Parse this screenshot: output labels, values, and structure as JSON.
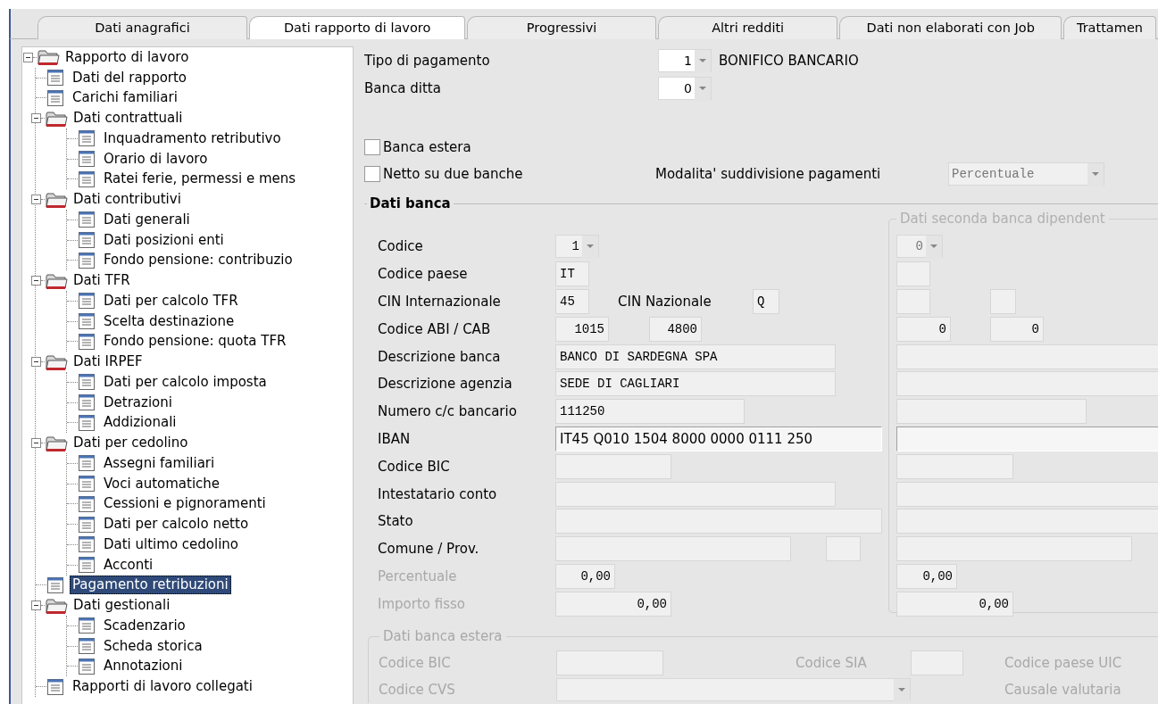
{
  "tabs": [
    {
      "label": "Dati anagrafici",
      "selected": false
    },
    {
      "label": "Dati rapporto di lavoro",
      "selected": true
    },
    {
      "label": "Progressivi",
      "selected": false
    },
    {
      "label": "Altri redditi",
      "selected": false
    },
    {
      "label": "Dati non elaborati con Job",
      "selected": false
    },
    {
      "label": "Trattamen",
      "selected": false
    }
  ],
  "tree": [
    {
      "label": "Rapporto di lavoro",
      "kind": "folder",
      "expanded": true,
      "selected": false,
      "children": [
        {
          "label": "Dati del rapporto",
          "kind": "page",
          "selected": false
        },
        {
          "label": "Carichi familiari",
          "kind": "page",
          "selected": false
        },
        {
          "label": "Dati contrattuali",
          "kind": "folder",
          "expanded": true,
          "selected": false,
          "children": [
            {
              "label": "Inquadramento retributivo",
              "kind": "page",
              "selected": false
            },
            {
              "label": "Orario di lavoro",
              "kind": "page",
              "selected": false
            },
            {
              "label": "Ratei ferie, permessi e mens",
              "kind": "page",
              "selected": false
            }
          ]
        },
        {
          "label": "Dati contributivi",
          "kind": "folder",
          "expanded": true,
          "selected": false,
          "children": [
            {
              "label": "Dati generali",
              "kind": "page",
              "selected": false
            },
            {
              "label": "Dati posizioni enti",
              "kind": "page",
              "selected": false
            },
            {
              "label": "Fondo pensione: contribuzio",
              "kind": "page",
              "selected": false
            }
          ]
        },
        {
          "label": "Dati TFR",
          "kind": "folder",
          "expanded": true,
          "selected": false,
          "children": [
            {
              "label": "Dati per calcolo TFR",
              "kind": "page",
              "selected": false
            },
            {
              "label": "Scelta destinazione",
              "kind": "page",
              "selected": false
            },
            {
              "label": "Fondo pensione: quota TFR",
              "kind": "page",
              "selected": false
            }
          ]
        },
        {
          "label": "Dati IRPEF",
          "kind": "folder",
          "expanded": true,
          "selected": false,
          "children": [
            {
              "label": "Dati per calcolo imposta",
              "kind": "page",
              "selected": false
            },
            {
              "label": "Detrazioni",
              "kind": "page",
              "selected": false
            },
            {
              "label": "Addizionali",
              "kind": "page",
              "selected": false
            }
          ]
        },
        {
          "label": "Dati per cedolino",
          "kind": "folder",
          "expanded": true,
          "selected": false,
          "children": [
            {
              "label": "Assegni familiari",
              "kind": "page",
              "selected": false
            },
            {
              "label": "Voci automatiche",
              "kind": "page",
              "selected": false
            },
            {
              "label": "Cessioni e pignoramenti",
              "kind": "page",
              "selected": false
            },
            {
              "label": "Dati per calcolo netto",
              "kind": "page",
              "selected": false
            },
            {
              "label": "Dati ultimo cedolino",
              "kind": "page",
              "selected": false
            },
            {
              "label": "Acconti",
              "kind": "page",
              "selected": false
            }
          ]
        },
        {
          "label": "Pagamento retribuzioni",
          "kind": "page",
          "selected": true
        },
        {
          "label": "Dati gestionali",
          "kind": "folder",
          "expanded": true,
          "selected": false,
          "children": [
            {
              "label": "Scadenzario",
              "kind": "page",
              "selected": false
            },
            {
              "label": "Scheda storica",
              "kind": "page",
              "selected": false
            },
            {
              "label": "Annotazioni",
              "kind": "page",
              "selected": false
            }
          ]
        },
        {
          "label": "Rapporti di lavoro collegati",
          "kind": "page",
          "selected": false
        }
      ]
    }
  ],
  "form": {
    "payment_type": {
      "label": "Tipo di pagamento",
      "value": "1",
      "description": "BONIFICO BANCARIO"
    },
    "company_bank": {
      "label": "Banca ditta",
      "value": "0"
    },
    "options": [
      {
        "label": "Banca estera",
        "checked": false
      },
      {
        "label": "Netto su due banche",
        "checked": false
      }
    ],
    "split_mode": {
      "label": "Modalita' suddivisione pagamenti",
      "value": "Percentuale",
      "disabled": true
    },
    "bank": {
      "title": "Dati banca",
      "second_title": "Dati seconda banca dipendent",
      "rows": [
        {
          "label": "Codice",
          "disabled": false,
          "fields": [
            {
              "kind": "combo",
              "value": "1"
            }
          ],
          "second": [
            {
              "kind": "combo",
              "value": "0"
            }
          ]
        },
        {
          "label": "Codice paese",
          "disabled": false,
          "fields": [
            {
              "kind": "field",
              "value": "IT"
            }
          ],
          "second": [
            {
              "kind": "field"
            }
          ]
        },
        {
          "label": "CIN Internazionale",
          "disabled": false,
          "fields": [
            {
              "kind": "field",
              "value": "45"
            },
            {
              "kind": "label",
              "text": "CIN Nazionale"
            },
            {
              "kind": "field",
              "value": "Q"
            }
          ],
          "second": [
            {
              "kind": "field"
            },
            {
              "kind": "field"
            }
          ]
        },
        {
          "label": "Codice ABI / CAB",
          "disabled": false,
          "fields": [
            {
              "kind": "number",
              "value": "1015"
            },
            {
              "kind": "number",
              "value": "4800"
            }
          ],
          "second": [
            {
              "kind": "number",
              "value": "0"
            },
            {
              "kind": "number",
              "value": "0"
            }
          ]
        },
        {
          "label": "Descrizione banca",
          "disabled": false,
          "fields": [
            {
              "kind": "field",
              "value": "BANCO DI SARDEGNA SPA"
            }
          ],
          "second": [
            {
              "kind": "field"
            }
          ]
        },
        {
          "label": "Descrizione agenzia",
          "disabled": false,
          "fields": [
            {
              "kind": "field",
              "value": "SEDE DI CAGLIARI"
            }
          ],
          "second": [
            {
              "kind": "field"
            }
          ]
        },
        {
          "label": "Numero c/c bancario",
          "disabled": false,
          "fields": [
            {
              "kind": "field",
              "value": "111250"
            }
          ],
          "second": [
            {
              "kind": "field"
            }
          ]
        },
        {
          "label": "IBAN",
          "disabled": false,
          "fields": [
            {
              "kind": "iban",
              "value": "IT45 Q010 1504 8000 0000 0111 250"
            }
          ],
          "second": [
            {
              "kind": "iban"
            }
          ]
        },
        {
          "label": "Codice BIC",
          "disabled": false,
          "fields": [
            {
              "kind": "field"
            }
          ],
          "second": [
            {
              "kind": "field"
            }
          ]
        },
        {
          "label": "Intestatario conto",
          "disabled": false,
          "fields": [
            {
              "kind": "field"
            }
          ],
          "second": [
            {
              "kind": "field"
            }
          ]
        },
        {
          "label": "Stato",
          "disabled": false,
          "fields": [
            {
              "kind": "field"
            }
          ],
          "second": [
            {
              "kind": "field"
            }
          ]
        },
        {
          "label": "Comune / Prov.",
          "disabled": false,
          "fields": [
            {
              "kind": "field"
            },
            {
              "kind": "field"
            }
          ],
          "second": [
            {
              "kind": "field"
            }
          ]
        },
        {
          "label": "Percentuale",
          "disabled": true,
          "fields": [
            {
              "kind": "number",
              "value": "0,00"
            }
          ],
          "second": [
            {
              "kind": "number",
              "value": "0,00"
            }
          ]
        },
        {
          "label": "Importo fisso",
          "disabled": true,
          "fields": [
            {
              "kind": "number",
              "value": "0,00"
            }
          ],
          "second": [
            {
              "kind": "number",
              "value": "0,00"
            }
          ]
        }
      ]
    },
    "foreign": {
      "title": "Dati banca estera",
      "disabled": true,
      "rows": [
        [
          {
            "kind": "label",
            "text": "Codice BIC"
          },
          {
            "kind": "field"
          },
          {
            "kind": "label",
            "text": "Codice SIA"
          },
          {
            "kind": "field"
          },
          {
            "kind": "label",
            "text": "Codice paese UIC"
          }
        ],
        [
          {
            "kind": "label",
            "text": "Codice CVS"
          },
          {
            "kind": "combo"
          },
          "",
          {
            "kind": "label",
            "text": "Causale valutaria"
          }
        ]
      ]
    }
  }
}
